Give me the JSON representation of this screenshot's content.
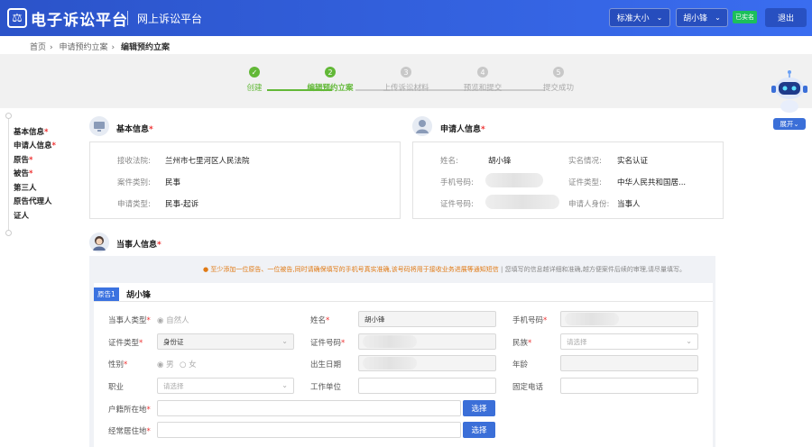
{
  "header": {
    "brand": "电子诉讼平台",
    "subbrand": "网上诉讼平台",
    "font_size_label": "标准大小",
    "user_name": "胡小锋",
    "verified_badge": "已实名",
    "exit_label": "退出"
  },
  "breadcrumb": [
    "首页",
    "申请预约立案",
    "编辑预约立案"
  ],
  "steps": [
    {
      "label": "创建",
      "state": "done"
    },
    {
      "label": "编辑预约立案",
      "state": "active",
      "num": "2"
    },
    {
      "label": "上传诉讼材料",
      "state": "todo",
      "num": "3"
    },
    {
      "label": "预览和提交",
      "state": "todo",
      "num": "4"
    },
    {
      "label": "提交成功",
      "state": "todo",
      "num": "5"
    }
  ],
  "sidebar": [
    {
      "label": "基本信息",
      "req": "*"
    },
    {
      "label": "申请人信息",
      "req": "*"
    },
    {
      "label": "原告",
      "req": "*"
    },
    {
      "label": "被告",
      "req": "*"
    },
    {
      "label": "第三人",
      "req": ""
    },
    {
      "label": "原告代理人",
      "req": ""
    },
    {
      "label": "证人",
      "req": ""
    }
  ],
  "basic": {
    "title": "基本信息",
    "req": "*",
    "court_label": "接收法院:",
    "court": "兰州市七里河区人民法院",
    "type_label": "案件类别:",
    "type": "民事",
    "apply_label": "申请类型:",
    "apply": "民事-起诉"
  },
  "applicant": {
    "title": "申请人信息",
    "req": "*",
    "name_label": "姓名:",
    "name": "胡小锋",
    "phone_label": "手机号码:",
    "id_label": "证件号码:",
    "realname_label": "实名情况:",
    "realname": "实名认证",
    "idtype_label": "证件类型:",
    "idtype": "中华人民共和国居...",
    "role_label": "申请人身份:",
    "role": "当事人"
  },
  "party": {
    "title": "当事人信息",
    "req": "*",
    "notice": "至少添加一位原告、一位被告,同时请确保填写的手机号真实准确,该号码将用于接收业务进展等通知短信",
    "tip": " | 您填写的信息越详细和准确,越方便案件后续的审理,请尽量填写。",
    "tag": "原告1",
    "name": "胡小锋"
  },
  "form": {
    "party_type_label": "当事人类型",
    "party_type_value": "自然人",
    "name_label": "姓名",
    "name_value": "胡小锋",
    "phone_label": "手机号码",
    "idtype_label": "证件类型",
    "idtype_value": "身份证",
    "idno_label": "证件号码",
    "ethnic_label": "民族",
    "ethnic_ph": "请选择",
    "gender_label": "性别",
    "gender_male": "男",
    "gender_female": "女",
    "birth_label": "出生日期",
    "age_label": "年龄",
    "job_label": "职业",
    "job_ph": "请选择",
    "work_label": "工作单位",
    "tel_label": "固定电话",
    "household_label": "户籍所在地",
    "residence_label": "经常居住地",
    "select_label": "选择"
  },
  "assistant": {
    "expand_label": "展开"
  },
  "colors": {
    "primary": "#3b6fd8",
    "success": "#62b837",
    "warning": "#e07a15",
    "required": "#e33333"
  }
}
